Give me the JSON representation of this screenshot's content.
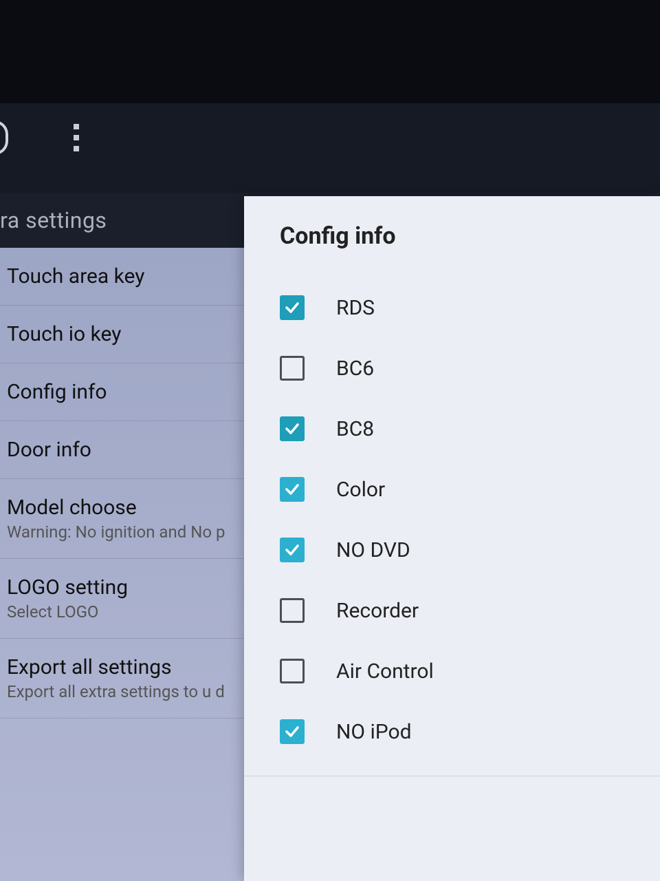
{
  "header": {
    "title": "ra settings"
  },
  "settings": {
    "items": [
      {
        "primary": "Touch area key",
        "secondary": ""
      },
      {
        "primary": "Touch io key",
        "secondary": ""
      },
      {
        "primary": "Config info",
        "secondary": ""
      },
      {
        "primary": "Door info",
        "secondary": ""
      },
      {
        "primary": "Model choose",
        "secondary": "Warning: No ignition and No p"
      },
      {
        "primary": "LOGO setting",
        "secondary": "Select LOGO"
      },
      {
        "primary": "Export all settings",
        "secondary": "Export all extra settings to u d"
      }
    ]
  },
  "dialog": {
    "title": "Config info",
    "options": [
      {
        "label": "RDS",
        "checked": true
      },
      {
        "label": "BC6",
        "checked": false
      },
      {
        "label": "BC8",
        "checked": true
      },
      {
        "label": "Color",
        "checked": true
      },
      {
        "label": "NO DVD",
        "checked": true
      },
      {
        "label": "Recorder",
        "checked": false
      },
      {
        "label": "Air Control",
        "checked": false
      },
      {
        "label": "NO iPod",
        "checked": true
      }
    ]
  }
}
